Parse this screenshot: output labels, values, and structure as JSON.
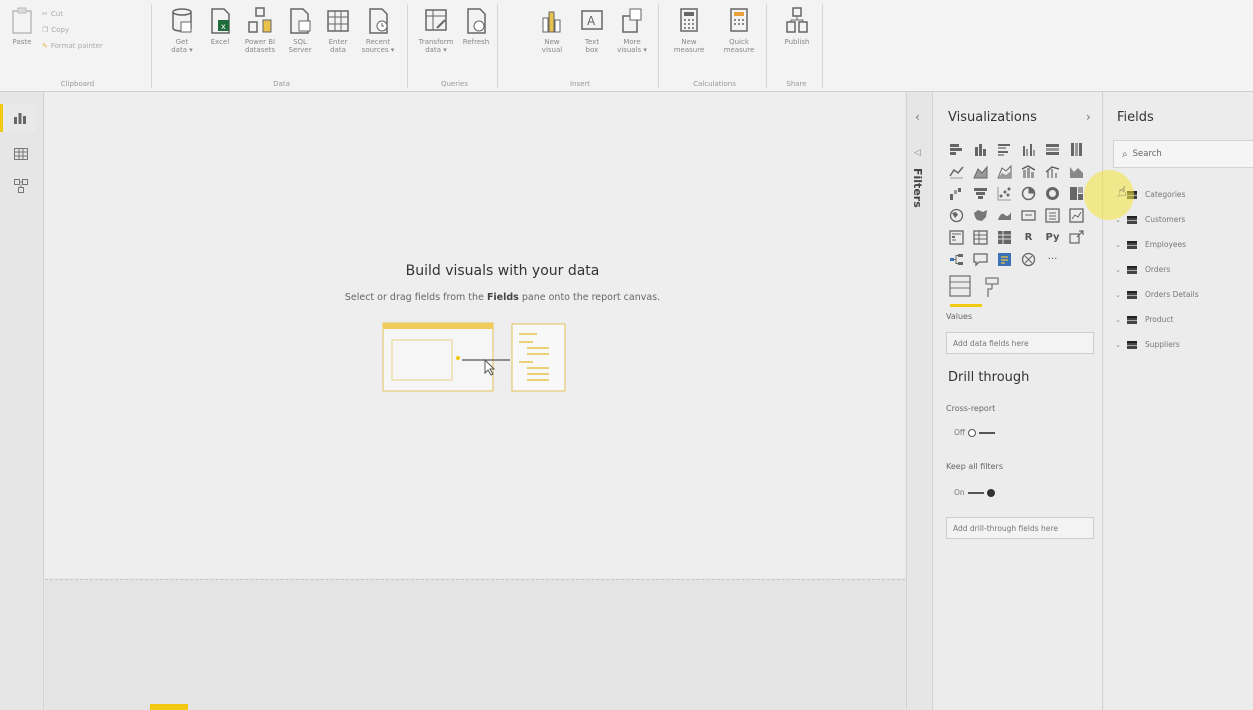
{
  "ribbon": {
    "clipboard": {
      "paste": "Paste",
      "cut": "Cut",
      "copy": "Copy",
      "format_painter": "Format painter",
      "group": "Clipboard"
    },
    "data": {
      "get_data": "Get\ndata ▾",
      "excel": "Excel",
      "powerbi": "Power BI\ndatasets",
      "sql": "SQL\nServer",
      "enter_data": "Enter\ndata",
      "recent": "Recent\nsources ▾",
      "group": "Data"
    },
    "queries": {
      "transform": "Transform\ndata ▾",
      "refresh": "Refresh",
      "group": "Queries"
    },
    "insert": {
      "new_visual": "New\nvisual",
      "text_box": "Text\nbox",
      "more_visuals": "More\nvisuals ▾",
      "group": "Insert"
    },
    "calculations": {
      "new_measure": "New\nmeasure",
      "quick_measure": "Quick\nmeasure",
      "group": "Calculations"
    },
    "share": {
      "publish": "Publish",
      "group": "Share"
    }
  },
  "canvas": {
    "title": "Build visuals with your data",
    "subtitle_before": "Select or drag fields from the",
    "subtitle_bold": "Fields",
    "subtitle_after": "pane onto the report canvas."
  },
  "filters": {
    "label": "Filters"
  },
  "visualizations": {
    "title": "Visualizations",
    "grid_row5": [
      "R",
      "Py"
    ],
    "values_label": "Values",
    "values_placeholder": "Add data fields here",
    "drill_title": "Drill through",
    "cross_report_label": "Cross-report",
    "cross_report_state": "Off",
    "keep_filters_label": "Keep all filters",
    "keep_filters_state": "On",
    "drill_placeholder": "Add drill-through fields here"
  },
  "fields": {
    "title": "Fields",
    "search_placeholder": "Search",
    "tables": [
      "Categories",
      "Customers",
      "Employees",
      "Orders",
      "Orders Details",
      "Product",
      "Suppliers"
    ]
  },
  "colors": {
    "accent": "#f2c811",
    "cursor_highlight": "#f5e63c"
  }
}
